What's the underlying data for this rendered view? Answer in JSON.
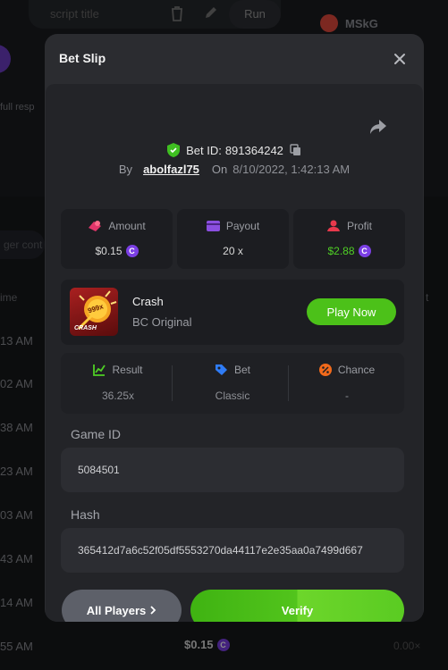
{
  "background": {
    "script_title_placeholder": "script title",
    "run_label": "Run",
    "user_name": "MSkG",
    "full_response_fragment": "full resp",
    "trigger_fragment": "ger cont",
    "time_header": "ime",
    "right_header": "t",
    "times": [
      "13 AM",
      "02 AM",
      "38 AM",
      "23 AM",
      "03 AM",
      "43 AM",
      "14 AM",
      "55 AM"
    ],
    "bottom_amount": "$0.15",
    "bottom_multiplier": "0.00×"
  },
  "modal": {
    "title": "Bet Slip",
    "bet_id_label": "Bet ID:",
    "bet_id": "891364242",
    "by_label": "By",
    "username": "abolfazl75",
    "on_label": "On",
    "date": "8/10/2022, 1:42:13 AM",
    "stats": {
      "amount_label": "Amount",
      "amount_value": "$0.15",
      "payout_label": "Payout",
      "payout_value": "20 x",
      "profit_label": "Profit",
      "profit_value": "$2.88"
    },
    "game": {
      "name": "Crash",
      "provider": "BC Original",
      "thumb_badge": "999x",
      "thumb_caption": "CRASH",
      "play_label": "Play Now"
    },
    "result": {
      "result_label": "Result",
      "result_value": "36.25x",
      "bet_label": "Bet",
      "bet_value": "Classic",
      "chance_label": "Chance",
      "chance_value": "-"
    },
    "game_id_label": "Game ID",
    "game_id": "5084501",
    "hash_label": "Hash",
    "hash": "365412d7a6c52f05df5553270da44117e2e35aa0a7499d667",
    "all_players_label": "All Players",
    "verify_label": "Verify"
  },
  "colors": {
    "accent_green": "#4cc119",
    "coin_purple": "#7b3fe4",
    "profit_green": "#4fcf25"
  }
}
